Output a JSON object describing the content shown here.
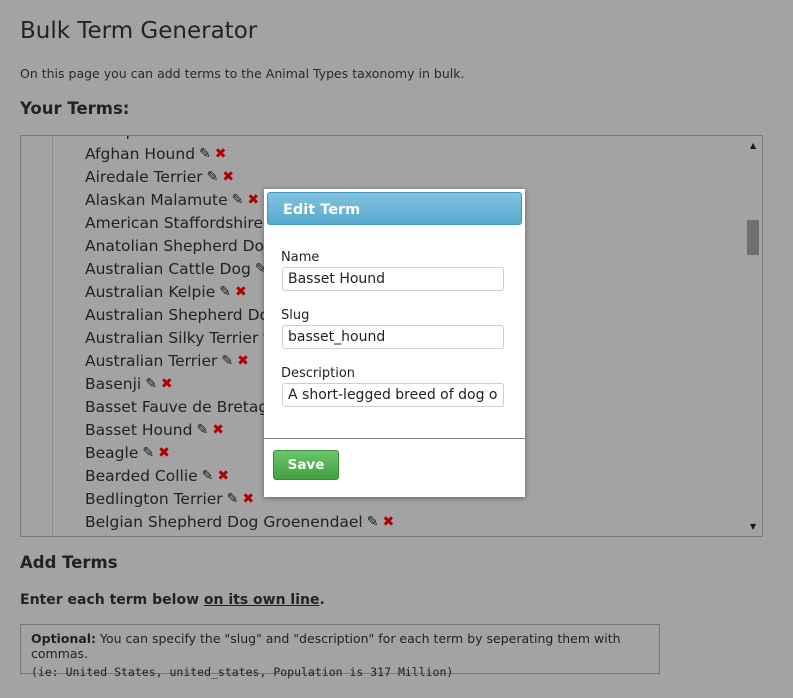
{
  "page": {
    "title": "Bulk Term Generator",
    "intro": "On this page you can add terms to the Animal Types taxonomy in bulk.",
    "your_terms_heading": "Your Terms:",
    "add_terms_heading": "Add Terms",
    "instructions_prefix": "Enter each term below ",
    "instructions_link": "on its own line",
    "instructions_suffix": ".",
    "optional_label": "Optional:",
    "optional_text": " You can specify the \"slug\" and \"description\" for each term by seperating them with commas.",
    "optional_example": "(ie: United States, united_states, Population is 317 Million)"
  },
  "terms": [
    "Affenpinscher",
    "Afghan Hound",
    "Airedale Terrier",
    "Alaskan Malamute",
    "American Staffordshire Bull Terrier",
    "Anatolian Shepherd Dog",
    "Australian Cattle Dog",
    "Australian Kelpie",
    "Australian Shepherd Dog",
    "Australian Silky Terrier",
    "Australian Terrier",
    "Basenji",
    "Basset Fauve de Bretagne",
    "Basset Hound",
    "Beagle",
    "Bearded Collie",
    "Bedlington Terrier",
    "Belgian Shepherd Dog Groenendael"
  ],
  "icons": {
    "edit": "pencil-icon",
    "delete": "delete-icon",
    "edit_glyph": "✎",
    "delete_glyph": "✖",
    "scroll_up_glyph": "▲",
    "scroll_down_glyph": "▼"
  },
  "scroll": {
    "position_fraction": 0.25
  },
  "modal": {
    "title": "Edit Term",
    "name_label": "Name",
    "name_value": "Basset Hound",
    "slug_label": "Slug",
    "slug_value": "basset_hound",
    "description_label": "Description",
    "description_value": "A short-legged breed of dog of the hound family",
    "save_label": "Save"
  },
  "colors": {
    "overlay": "#a3a3a3",
    "modal_header": "#57a9cf",
    "save_button": "#41a141",
    "delete_icon": "#b00000"
  }
}
